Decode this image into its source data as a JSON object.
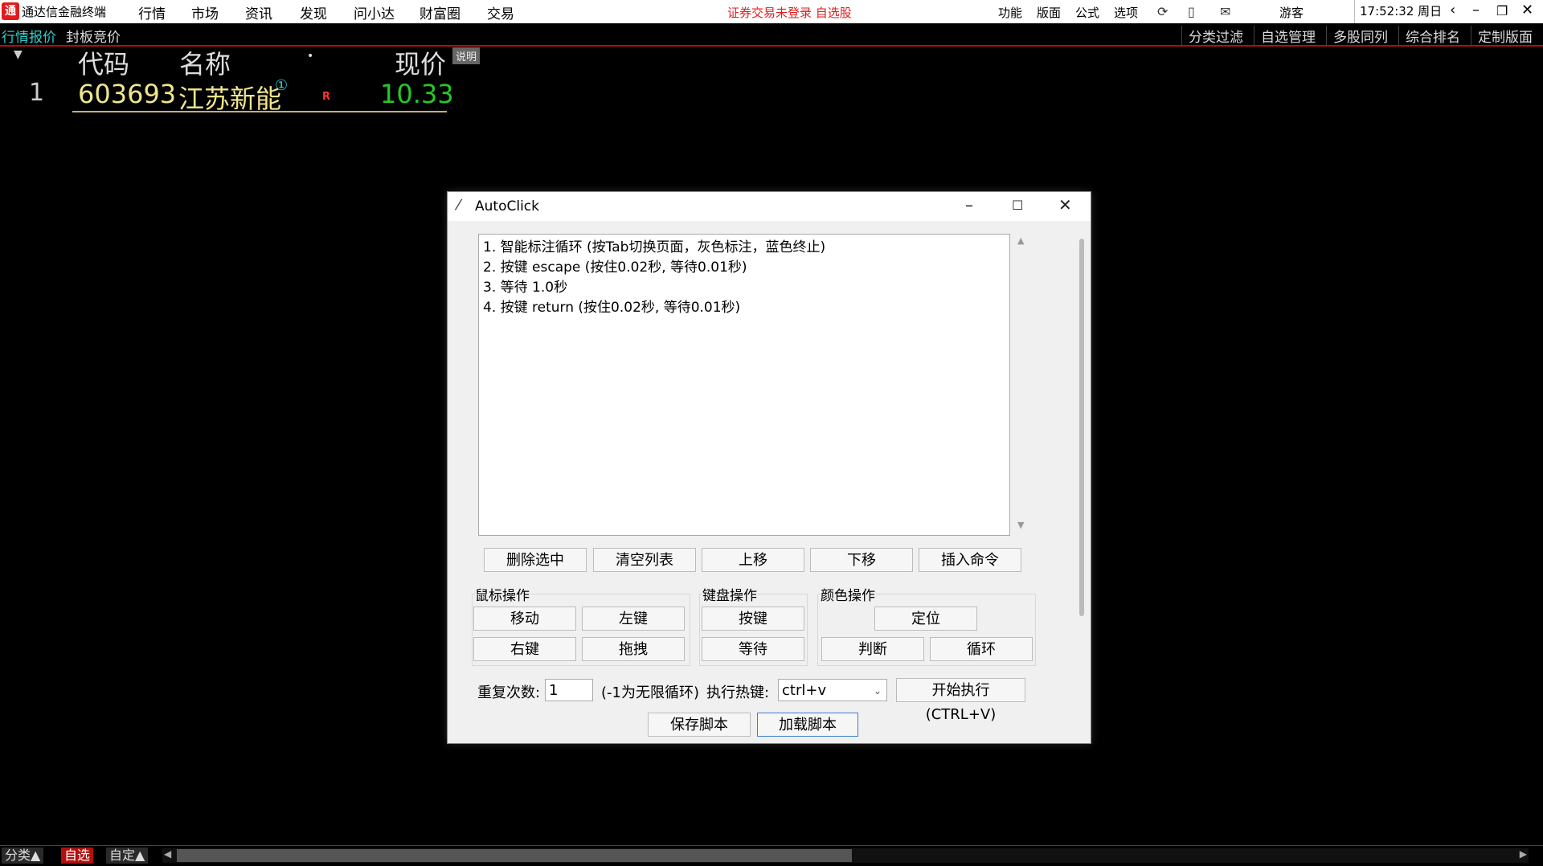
{
  "app": {
    "title": "通达信金融终端",
    "logo_text": "通",
    "menu": [
      "行情",
      "市场",
      "资讯",
      "发现",
      "问小达",
      "财富圈",
      "交易"
    ],
    "status_warning": "证券交易未登录  自选股",
    "right_menu": [
      "功能",
      "版面",
      "公式",
      "选项"
    ],
    "user": "游客",
    "clock": "17:52:32 周日"
  },
  "tabs": {
    "left": [
      "行情报价",
      "封板竞价"
    ],
    "right": [
      "分类过滤",
      "自选管理",
      "多股同列",
      "综合排名",
      "定制版面"
    ]
  },
  "quote_table": {
    "headers": {
      "code": "代码",
      "name": "名称",
      "price": "现价"
    },
    "explain_badge": "说明",
    "rows": [
      {
        "index": "1",
        "code": "603693",
        "name": "江苏新能",
        "marker": "①",
        "flag": "R",
        "price": "10.33"
      }
    ]
  },
  "dialog": {
    "title": "AutoClick",
    "commands": [
      "1. 智能标注循环 (按Tab切换页面，灰色标注，蓝色终止)",
      "2. 按键 escape (按住0.02秒, 等待0.01秒)",
      "3. 等待 1.0秒",
      "4. 按键 return (按住0.02秒, 等待0.01秒)"
    ],
    "list_buttons": [
      "删除选中",
      "清空列表",
      "上移",
      "下移",
      "插入命令"
    ],
    "mouse_group": {
      "label": "鼠标操作",
      "buttons": [
        "移动",
        "左键",
        "右键",
        "拖拽"
      ]
    },
    "keyboard_group": {
      "label": "键盘操作",
      "buttons": [
        "按键",
        "等待"
      ]
    },
    "color_group": {
      "label": "颜色操作",
      "buttons": [
        "定位",
        "判断",
        "循环"
      ]
    },
    "repeat_label": "重复次数:",
    "repeat_value": "1",
    "repeat_hint": "(-1为无限循环)",
    "hotkey_label": "执行热键:",
    "hotkey_value": "ctrl+v",
    "start_button": "开始执行(CTRL+V)",
    "save_button": "保存脚本",
    "load_button": "加载脚本"
  },
  "bottom_tabs": [
    "分类▲",
    "自选",
    "自定▲"
  ],
  "colors": {
    "brand_red": "#e31b1b",
    "code_yellow": "#f0e68c",
    "price_green": "#22cc22",
    "tab_cyan": "#33cccc"
  }
}
